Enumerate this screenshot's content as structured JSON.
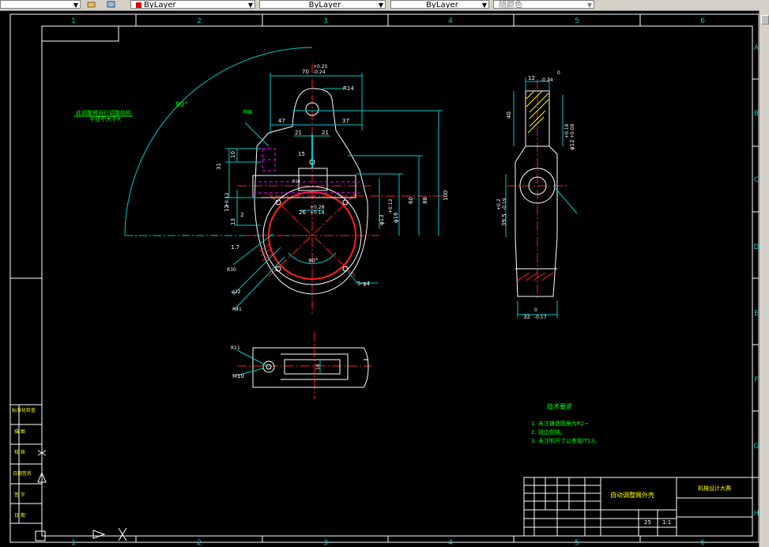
{
  "toolbar": {
    "color_combo": "ByLayer",
    "linetype_combo": "ByLayer",
    "lineweight_combo": "ByLayer",
    "plotstyle_combo": "随颜色"
  },
  "frame": {
    "col_labels": [
      "1",
      "2",
      "3",
      "4",
      "5",
      "6"
    ],
    "row_labels": [
      "A",
      "B",
      "C",
      "D",
      "E",
      "F",
      "G",
      "H"
    ]
  },
  "dims": {
    "top_width": "70",
    "top_tol_up": "+0.25",
    "top_tol_dn": "-0.24",
    "dim47": "47",
    "dim37": "37",
    "dim21a": "21",
    "dim21b": "21",
    "r14": "R14",
    "r14_small": "R14",
    "dim31": "31",
    "dim10": "10",
    "dim15": "15",
    "dim13": "13",
    "dim12": "12",
    "dim26": "26",
    "dim26_tol": "+0.28",
    "dim26_tol2": "+0.14",
    "dim60": "60",
    "dim88": "88",
    "dim100": "100",
    "phi13": "φ13",
    "phi16": "φ16",
    "tol012a": "+0.12",
    "tol012b": "+0.12",
    "dim2": "2",
    "dim1_7": "1.7",
    "angle90": "90°",
    "angle90b": "90°",
    "r30": "R30",
    "phi22": "φ22",
    "r41": "R41",
    "holes": "5-φ4",
    "dim_side": "32",
    "side_tol": "-0.17",
    "side_top": "12",
    "side_top_tol": "-0.24",
    "side_top_0": "0",
    "side_bot_0": "0",
    "dim40": "40",
    "dim39": "39.5",
    "dim39_tol": "-0.19",
    "dim39_tol2": "+0.2",
    "phi12": "φ12",
    "phi12_tol": "+0.18",
    "phi12_tol2": "+0.08",
    "b_r11": "R11",
    "b_m10": "M10",
    "b_18": "18",
    "weld": "焊缝"
  },
  "notes": {
    "left_note1": "此调整臂自行调整结构",
    "left_note2": "半径不大于R",
    "tech_title": "技术要求",
    "tech1": "1. 未注铸造圆角为R2~",
    "tech2": "2. 锐边倒钝。",
    "tech3": "3. 未注明尺寸公差按IT13。"
  },
  "title_block": {
    "part_name": "自动调整臂外壳",
    "company": "机械设计大赛",
    "scale": "1:1",
    "sheet": "25"
  },
  "side_labels": [
    "标准化检查",
    "描 图",
    "校 核",
    "日期签名",
    "签 字",
    "日 期"
  ],
  "colors": {
    "frame": "#ffffff",
    "dim": "#00c8c8",
    "text_green": "#00ff00",
    "text_yellow": "#ffff00",
    "center": "#ff2020",
    "hidden": "#ff00ff",
    "hatch": "#ffff00"
  }
}
